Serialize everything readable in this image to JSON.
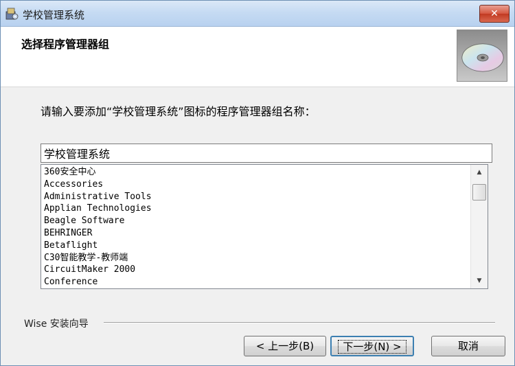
{
  "window": {
    "title": "学校管理系统",
    "close_label": "✕"
  },
  "header": {
    "title": "选择程序管理器组"
  },
  "instruction": "请输入要添加“学校管理系统”图标的程序管理器组名称：",
  "group_name_value": "学校管理系统",
  "program_groups": [
    "360安全中心",
    "Accessories",
    "Administrative Tools",
    "Applian Technologies",
    "Beagle Software",
    "BEHRINGER",
    "Betaflight",
    "C30智能教学-教师端",
    "CircuitMaker 2000",
    "Conference"
  ],
  "footer": {
    "wise_label": "Wise 安装向导"
  },
  "buttons": {
    "back": "< 上一步(B)",
    "next": "下一步(N) >",
    "cancel": "取消"
  },
  "icons": {
    "app": "installer-app-icon",
    "header": "cd-disc-icon",
    "close": "close-icon",
    "scroll_up": "scroll-up-arrow-icon",
    "scroll_down": "scroll-down-arrow-icon"
  },
  "colors": {
    "close_button": "#c13a22",
    "titlebar": "#c6dbf3",
    "focus_border": "#3c7fb1"
  }
}
